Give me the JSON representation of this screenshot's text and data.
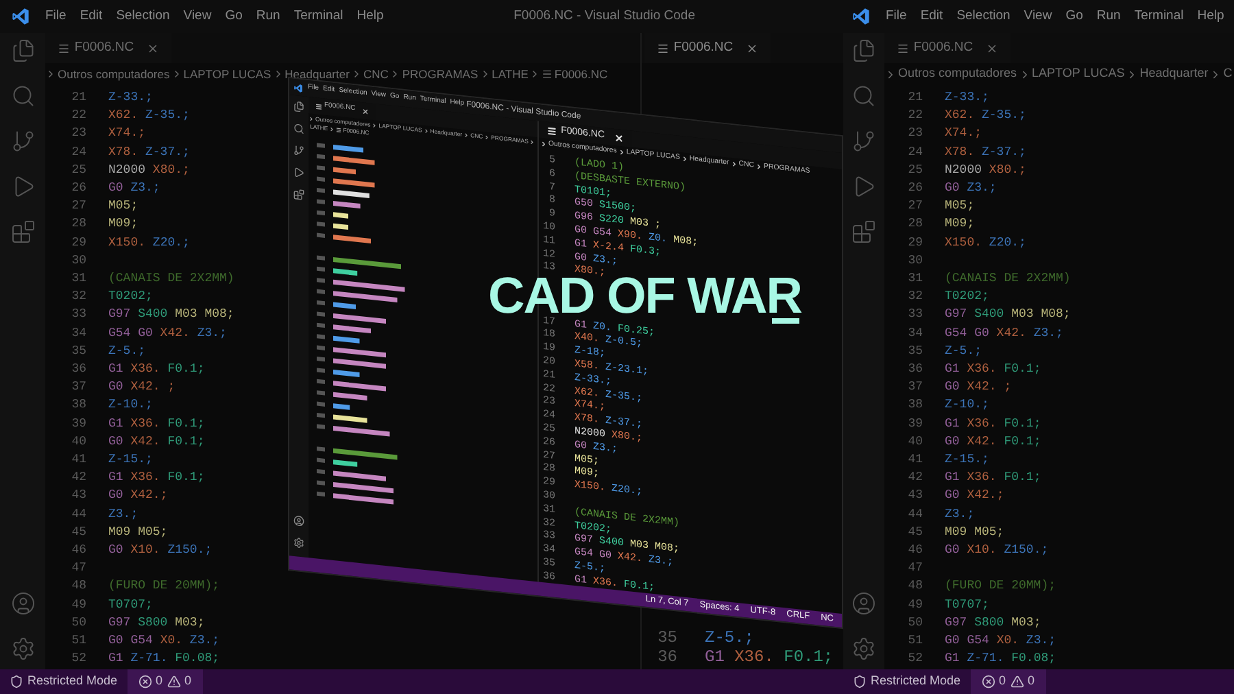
{
  "left_window": {
    "title": "F0006.NC - Visual Studio Code",
    "menu": [
      "File",
      "Edit",
      "Selection",
      "View",
      "Go",
      "Run",
      "Terminal",
      "Help"
    ],
    "groups": [
      {
        "tab": {
          "label": "F0006.NC"
        },
        "breadcrumb": {
          "path": [
            "Outros computadores",
            "LAPTOP LUCAS",
            "Headquarter",
            "CNC",
            "PROGRAMAS",
            "LATHE"
          ],
          "file": "F0006.NC"
        },
        "lines": [
          {
            "number": "21",
            "tokens": [
              {
                "text": "Z-33.;",
                "kind": "z"
              }
            ]
          },
          {
            "number": "22",
            "tokens": [
              {
                "text": "X62.",
                "kind": "x"
              },
              {
                "text": "Z-35.;",
                "kind": "z"
              }
            ]
          },
          {
            "number": "23",
            "tokens": [
              {
                "text": "X74.;",
                "kind": "x"
              }
            ]
          },
          {
            "number": "24",
            "tokens": [
              {
                "text": "X78.",
                "kind": "x"
              },
              {
                "text": "Z-37.;",
                "kind": "z"
              }
            ]
          },
          {
            "number": "25",
            "tokens": [
              {
                "text": "N2000",
                "kind": "n"
              },
              {
                "text": "X80.;",
                "kind": "x"
              }
            ]
          },
          {
            "number": "26",
            "tokens": [
              {
                "text": "G0",
                "kind": "g"
              },
              {
                "text": "Z3.;",
                "kind": "z"
              }
            ]
          },
          {
            "number": "27",
            "tokens": [
              {
                "text": "M05;",
                "kind": "m"
              }
            ]
          },
          {
            "number": "28",
            "tokens": [
              {
                "text": "M09;",
                "kind": "m"
              }
            ]
          },
          {
            "number": "29",
            "tokens": [
              {
                "text": "X150.",
                "kind": "x"
              },
              {
                "text": "Z20.;",
                "kind": "z"
              }
            ]
          },
          {
            "number": "30"
          },
          {
            "number": "31",
            "tokens": [
              {
                "text": "(CANAIS DE 2X2MM)",
                "kind": "c"
              }
            ]
          },
          {
            "number": "32",
            "tokens": [
              {
                "text": "T0202;",
                "kind": "t"
              }
            ]
          },
          {
            "number": "33",
            "tokens": [
              {
                "text": "G97",
                "kind": "g"
              },
              {
                "text": "S400",
                "kind": "t"
              },
              {
                "text": "M03",
                "kind": "m"
              },
              {
                "text": "M08;",
                "kind": "m"
              }
            ]
          },
          {
            "number": "34",
            "tokens": [
              {
                "text": "G54",
                "kind": "g"
              },
              {
                "text": "G0",
                "kind": "g"
              },
              {
                "text": "X42.",
                "kind": "x"
              },
              {
                "text": "Z3.;",
                "kind": "z"
              }
            ]
          },
          {
            "number": "35",
            "tokens": [
              {
                "text": "Z-5.;",
                "kind": "z"
              }
            ]
          },
          {
            "number": "36",
            "tokens": [
              {
                "text": "G1",
                "kind": "g"
              },
              {
                "text": "X36.",
                "kind": "x"
              },
              {
                "text": "F0.1;",
                "kind": "t"
              }
            ]
          },
          {
            "number": "37",
            "tokens": [
              {
                "text": "G0",
                "kind": "g"
              },
              {
                "text": "X42. ;",
                "kind": "x"
              }
            ]
          },
          {
            "number": "38",
            "tokens": [
              {
                "text": "Z-10.;",
                "kind": "z"
              }
            ]
          },
          {
            "number": "39",
            "tokens": [
              {
                "text": "G1",
                "kind": "g"
              },
              {
                "text": "X36.",
                "kind": "x"
              },
              {
                "text": "F0.1;",
                "kind": "t"
              }
            ]
          },
          {
            "number": "40",
            "tokens": [
              {
                "text": "G0",
                "kind": "g"
              },
              {
                "text": "X42.",
                "kind": "x"
              },
              {
                "text": "F0.1;",
                "kind": "t"
              }
            ]
          },
          {
            "number": "41",
            "tokens": [
              {
                "text": "Z-15.;",
                "kind": "z"
              }
            ]
          },
          {
            "number": "42",
            "tokens": [
              {
                "text": "G1",
                "kind": "g"
              },
              {
                "text": "X36.",
                "kind": "x"
              },
              {
                "text": "F0.1;",
                "kind": "t"
              }
            ]
          },
          {
            "number": "43",
            "tokens": [
              {
                "text": "G0",
                "kind": "g"
              },
              {
                "text": "X42.;",
                "kind": "x"
              }
            ]
          },
          {
            "number": "44",
            "tokens": [
              {
                "text": "Z3.;",
                "kind": "z"
              }
            ]
          },
          {
            "number": "45",
            "tokens": [
              {
                "text": "M09",
                "kind": "m"
              },
              {
                "text": "M05;",
                "kind": "m"
              }
            ]
          },
          {
            "number": "46",
            "tokens": [
              {
                "text": "G0",
                "kind": "g"
              },
              {
                "text": "X10.",
                "kind": "x"
              },
              {
                "text": "Z150.;",
                "kind": "z"
              }
            ]
          },
          {
            "number": "47"
          },
          {
            "number": "48",
            "tokens": [
              {
                "text": "(FURO DE 20MM);",
                "kind": "c"
              }
            ]
          },
          {
            "number": "49",
            "tokens": [
              {
                "text": "T0707;",
                "kind": "t"
              }
            ]
          },
          {
            "number": "50",
            "tokens": [
              {
                "text": "G97",
                "kind": "g"
              },
              {
                "text": "S800",
                "kind": "t"
              },
              {
                "text": "M03;",
                "kind": "m"
              }
            ]
          },
          {
            "number": "51",
            "tokens": [
              {
                "text": "G0",
                "kind": "g"
              },
              {
                "text": "G54",
                "kind": "g"
              },
              {
                "text": "X0.",
                "kind": "x"
              },
              {
                "text": "Z3.;",
                "kind": "z"
              }
            ]
          },
          {
            "number": "52",
            "tokens": [
              {
                "text": "G1",
                "kind": "g"
              },
              {
                "text": "Z-71.",
                "kind": "z"
              },
              {
                "text": "F0.08;",
                "kind": "t"
              }
            ]
          }
        ]
      },
      {
        "tab": {
          "label": "F0006.NC"
        },
        "lines": [
          {
            "number": "35",
            "tokens": [
              {
                "text": "Z-5.;",
                "kind": "z"
              }
            ]
          },
          {
            "number": "36",
            "tokens": [
              {
                "text": "G1",
                "kind": "g"
              },
              {
                "text": "X36.",
                "kind": "x"
              },
              {
                "text": "F0.1;",
                "kind": "t"
              }
            ]
          }
        ]
      }
    ],
    "status_bar": {
      "mode": "Restricted Mode",
      "errors": "0",
      "warnings": "0"
    }
  },
  "tilted_window": {
    "title": "F0006.NC - Visual Studio Code",
    "menu": [
      "File",
      "Edit",
      "Selection",
      "View",
      "Go",
      "Run",
      "Terminal",
      "Help"
    ],
    "left_group": {
      "tab": {
        "label": "F0006.NC"
      },
      "breadcrumb": {
        "path": [
          "Outros computadores",
          "LAPTOP LUCAS",
          "Headquarter",
          "CNC",
          "PROGRAMAS",
          "LATHE"
        ],
        "file": "F0006.NC"
      }
    },
    "right_group": {
      "tab": {
        "label": "F0006.NC"
      },
      "breadcrumb": {
        "path": [
          "Outros computadores",
          "LAPTOP LUCAS",
          "Headquarter",
          "CNC",
          "PROGRAMAS"
        ]
      },
      "lines": [
        {
          "number": "5",
          "tokens": [
            {
              "text": "(LADO 1)",
              "kind": "c"
            }
          ]
        },
        {
          "number": "6",
          "tokens": [
            {
              "text": "(DESBASTE EXTERNO)",
              "kind": "c"
            }
          ]
        },
        {
          "number": "7",
          "tokens": [
            {
              "text": "T0101;",
              "kind": "t"
            }
          ]
        },
        {
          "number": "8",
          "tokens": [
            {
              "text": "G50",
              "kind": "g"
            },
            {
              "text": "S1500;",
              "kind": "t"
            }
          ]
        },
        {
          "number": "9",
          "tokens": [
            {
              "text": "G96",
              "kind": "g"
            },
            {
              "text": "S220",
              "kind": "t"
            },
            {
              "text": "M03 ;",
              "kind": "m"
            }
          ]
        },
        {
          "number": "10",
          "tokens": [
            {
              "text": "G0",
              "kind": "g"
            },
            {
              "text": "G54",
              "kind": "g"
            },
            {
              "text": "X90.",
              "kind": "x"
            },
            {
              "text": "Z0.",
              "kind": "z"
            },
            {
              "text": "M08;",
              "kind": "m"
            }
          ]
        },
        {
          "number": "11",
          "tokens": [
            {
              "text": "G1",
              "kind": "g"
            },
            {
              "text": "X-2.4",
              "kind": "x"
            },
            {
              "text": "F0.3;",
              "kind": "t"
            }
          ]
        },
        {
          "number": "12",
          "tokens": [
            {
              "text": "G0",
              "kind": "g"
            },
            {
              "text": "Z3.;",
              "kind": "z"
            }
          ]
        },
        {
          "number": "13",
          "tokens": [
            {
              "text": "X80.;",
              "kind": "x"
            }
          ]
        }
      ],
      "lines_below_headline": [
        {
          "number": "17",
          "tokens": [
            {
              "text": "G1",
              "kind": "g"
            },
            {
              "text": "Z0.",
              "kind": "z"
            },
            {
              "text": "F0.25;",
              "kind": "t"
            }
          ]
        },
        {
          "number": "18",
          "tokens": [
            {
              "text": "X40.",
              "kind": "x"
            },
            {
              "text": "Z-0.5;",
              "kind": "z"
            }
          ]
        },
        {
          "number": "19",
          "tokens": [
            {
              "text": "Z-18;",
              "kind": "z"
            }
          ]
        },
        {
          "number": "20",
          "tokens": [
            {
              "text": "X58.",
              "kind": "x"
            },
            {
              "text": "Z-23.1;",
              "kind": "z"
            }
          ]
        },
        {
          "number": "21",
          "tokens": [
            {
              "text": "Z-33.;",
              "kind": "z"
            }
          ]
        },
        {
          "number": "22",
          "tokens": [
            {
              "text": "X62.",
              "kind": "x"
            },
            {
              "text": "Z-35.;",
              "kind": "z"
            }
          ]
        },
        {
          "number": "23",
          "tokens": [
            {
              "text": "X74.;",
              "kind": "x"
            }
          ]
        },
        {
          "number": "24",
          "tokens": [
            {
              "text": "X78.",
              "kind": "x"
            },
            {
              "text": "Z-37.;",
              "kind": "z"
            }
          ]
        },
        {
          "number": "25",
          "tokens": [
            {
              "text": "N2000",
              "kind": "n"
            },
            {
              "text": "X80.;",
              "kind": "x"
            }
          ]
        },
        {
          "number": "26",
          "tokens": [
            {
              "text": "G0",
              "kind": "g"
            },
            {
              "text": "Z3.;",
              "kind": "z"
            }
          ]
        },
        {
          "number": "27",
          "tokens": [
            {
              "text": "M05;",
              "kind": "m"
            }
          ]
        },
        {
          "number": "28",
          "tokens": [
            {
              "text": "M09;",
              "kind": "m"
            }
          ]
        },
        {
          "number": "29",
          "tokens": [
            {
              "text": "X150.",
              "kind": "x"
            },
            {
              "text": "Z20.;",
              "kind": "z"
            }
          ]
        },
        {
          "number": "30"
        },
        {
          "number": "31",
          "tokens": [
            {
              "text": "(CANAIS DE 2X2MM)",
              "kind": "c"
            }
          ]
        },
        {
          "number": "32",
          "tokens": [
            {
              "text": "T0202;",
              "kind": "t"
            }
          ]
        },
        {
          "number": "33",
          "tokens": [
            {
              "text": "G97",
              "kind": "g"
            },
            {
              "text": "S400",
              "kind": "t"
            },
            {
              "text": "M03",
              "kind": "m"
            },
            {
              "text": "M08;",
              "kind": "m"
            }
          ]
        },
        {
          "number": "34",
          "tokens": [
            {
              "text": "G54",
              "kind": "g"
            },
            {
              "text": "G0",
              "kind": "g"
            },
            {
              "text": "X42.",
              "kind": "x"
            },
            {
              "text": "Z3.;",
              "kind": "z"
            }
          ]
        },
        {
          "number": "35",
          "tokens": [
            {
              "text": "Z-5.;",
              "kind": "z"
            }
          ]
        },
        {
          "number": "36",
          "tokens": [
            {
              "text": "G1",
              "kind": "g"
            },
            {
              "text": "X36.",
              "kind": "x"
            },
            {
              "text": "F0.1;",
              "kind": "t"
            }
          ]
        }
      ]
    },
    "status_bar": {
      "right": [
        "Ln 7, Col 7",
        "Spaces: 4",
        "UTF-8",
        "CRLF",
        "NC"
      ]
    }
  },
  "right_window": {
    "menu": [
      "File",
      "Edit",
      "Selection",
      "View",
      "Go",
      "Run",
      "Terminal",
      "Help"
    ],
    "tab": {
      "label": "F0006.NC"
    },
    "breadcrumb": {
      "path": [
        "Outros computadores",
        "LAPTOP LUCAS",
        "Headquarter",
        "C"
      ]
    },
    "lines": [
      {
        "number": "21",
        "tokens": [
          {
            "text": "Z-33.;",
            "kind": "z"
          }
        ]
      },
      {
        "number": "22",
        "tokens": [
          {
            "text": "X62.",
            "kind": "x"
          },
          {
            "text": "Z-35.;",
            "kind": "z"
          }
        ]
      },
      {
        "number": "23",
        "tokens": [
          {
            "text": "X74.;",
            "kind": "x"
          }
        ]
      },
      {
        "number": "24",
        "tokens": [
          {
            "text": "X78.",
            "kind": "x"
          },
          {
            "text": "Z-37.;",
            "kind": "z"
          }
        ]
      },
      {
        "number": "25",
        "tokens": [
          {
            "text": "N2000",
            "kind": "n"
          },
          {
            "text": "X80.;",
            "kind": "x"
          }
        ]
      },
      {
        "number": "26",
        "tokens": [
          {
            "text": "G0",
            "kind": "g"
          },
          {
            "text": "Z3.;",
            "kind": "z"
          }
        ]
      },
      {
        "number": "27",
        "tokens": [
          {
            "text": "M05;",
            "kind": "m"
          }
        ]
      },
      {
        "number": "28",
        "tokens": [
          {
            "text": "M09;",
            "kind": "m"
          }
        ]
      },
      {
        "number": "29",
        "tokens": [
          {
            "text": "X150.",
            "kind": "x"
          },
          {
            "text": "Z20.;",
            "kind": "z"
          }
        ]
      },
      {
        "number": "30"
      },
      {
        "number": "31",
        "tokens": [
          {
            "text": "(CANAIS DE 2X2MM)",
            "kind": "c"
          }
        ]
      },
      {
        "number": "32",
        "tokens": [
          {
            "text": "T0202;",
            "kind": "t"
          }
        ]
      },
      {
        "number": "33",
        "tokens": [
          {
            "text": "G97",
            "kind": "g"
          },
          {
            "text": "S400",
            "kind": "t"
          },
          {
            "text": "M03",
            "kind": "m"
          },
          {
            "text": "M08;",
            "kind": "m"
          }
        ]
      },
      {
        "number": "34",
        "tokens": [
          {
            "text": "G54",
            "kind": "g"
          },
          {
            "text": "G0",
            "kind": "g"
          },
          {
            "text": "X42.",
            "kind": "x"
          },
          {
            "text": "Z3.;",
            "kind": "z"
          }
        ]
      },
      {
        "number": "35",
        "tokens": [
          {
            "text": "Z-5.;",
            "kind": "z"
          }
        ]
      },
      {
        "number": "36",
        "tokens": [
          {
            "text": "G1",
            "kind": "g"
          },
          {
            "text": "X36.",
            "kind": "x"
          },
          {
            "text": "F0.1;",
            "kind": "t"
          }
        ]
      },
      {
        "number": "37",
        "tokens": [
          {
            "text": "G0",
            "kind": "g"
          },
          {
            "text": "X42. ;",
            "kind": "x"
          }
        ]
      },
      {
        "number": "38",
        "tokens": [
          {
            "text": "Z-10.;",
            "kind": "z"
          }
        ]
      },
      {
        "number": "39",
        "tokens": [
          {
            "text": "G1",
            "kind": "g"
          },
          {
            "text": "X36.",
            "kind": "x"
          },
          {
            "text": "F0.1;",
            "kind": "t"
          }
        ]
      },
      {
        "number": "40",
        "tokens": [
          {
            "text": "G0",
            "kind": "g"
          },
          {
            "text": "X42.",
            "kind": "x"
          },
          {
            "text": "F0.1;",
            "kind": "t"
          }
        ]
      },
      {
        "number": "41",
        "tokens": [
          {
            "text": "Z-15.;",
            "kind": "z"
          }
        ]
      },
      {
        "number": "42",
        "tokens": [
          {
            "text": "G1",
            "kind": "g"
          },
          {
            "text": "X36.",
            "kind": "x"
          },
          {
            "text": "F0.1;",
            "kind": "t"
          }
        ]
      },
      {
        "number": "43",
        "tokens": [
          {
            "text": "G0",
            "kind": "g"
          },
          {
            "text": "X42.;",
            "kind": "x"
          }
        ]
      },
      {
        "number": "44",
        "tokens": [
          {
            "text": "Z3.;",
            "kind": "z"
          }
        ]
      },
      {
        "number": "45",
        "tokens": [
          {
            "text": "M09",
            "kind": "m"
          },
          {
            "text": "M05;",
            "kind": "m"
          }
        ]
      },
      {
        "number": "46",
        "tokens": [
          {
            "text": "G0",
            "kind": "g"
          },
          {
            "text": "X10.",
            "kind": "x"
          },
          {
            "text": "Z150.;",
            "kind": "z"
          }
        ]
      },
      {
        "number": "47"
      },
      {
        "number": "48",
        "tokens": [
          {
            "text": "(FURO DE 20MM);",
            "kind": "c"
          }
        ]
      },
      {
        "number": "49",
        "tokens": [
          {
            "text": "T0707;",
            "kind": "t"
          }
        ]
      },
      {
        "number": "50",
        "tokens": [
          {
            "text": "G97",
            "kind": "g"
          },
          {
            "text": "S800",
            "kind": "t"
          },
          {
            "text": "M03;",
            "kind": "m"
          }
        ]
      },
      {
        "number": "51",
        "tokens": [
          {
            "text": "G0",
            "kind": "g"
          },
          {
            "text": "G54",
            "kind": "g"
          },
          {
            "text": "X0.",
            "kind": "x"
          },
          {
            "text": "Z3.;",
            "kind": "z"
          }
        ]
      },
      {
        "number": "52",
        "tokens": [
          {
            "text": "G1",
            "kind": "g"
          },
          {
            "text": "Z-71.",
            "kind": "z"
          },
          {
            "text": "F0.08;",
            "kind": "t"
          }
        ]
      }
    ],
    "status_bar": {
      "mode": "Restricted Mode",
      "errors": "0",
      "warnings": "0"
    }
  },
  "headline": "CAD OF WAR"
}
